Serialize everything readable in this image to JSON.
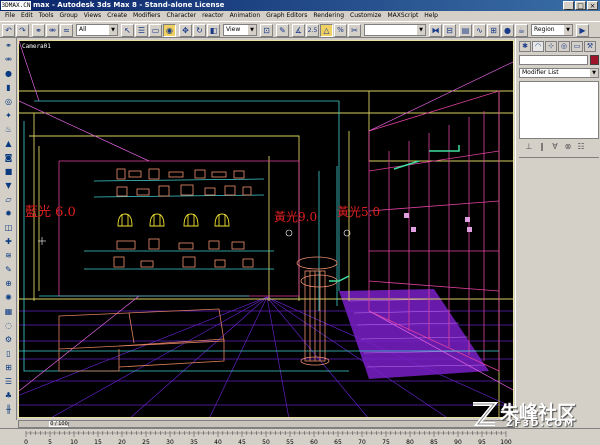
{
  "window": {
    "logo_text": "3DMAX.CN",
    "title": "max - Autodesk 3ds Max 8 - Stand-alone License",
    "controls": [
      "_",
      "□",
      "×"
    ]
  },
  "menu": [
    "File",
    "Edit",
    "Tools",
    "Group",
    "Views",
    "Create",
    "Modifiers",
    "Character",
    "reactor",
    "Animation",
    "Graph Editors",
    "Rendering",
    "Customize",
    "MAXScript",
    "Help"
  ],
  "toolbar": {
    "selection_filter": "All",
    "coord_system": "View",
    "snap_label": "2.5",
    "percent_snap_label": "%",
    "named_selection": "",
    "render_preset": "Region"
  },
  "viewport": {
    "label": "Camera01",
    "annotations": [
      "藍光 6.0",
      "黃光9.0",
      "黃光5.0"
    ],
    "colors": {
      "background": "#000000",
      "room": "#d8d060",
      "cyan_wire": "#40d0d0",
      "pink_wire": "#e040a0",
      "magenta_lines": "#e060e0",
      "floor_grid": "#6020c0",
      "shelf_items": "#f09070",
      "lamp": "#f0e030",
      "tub": "#9030d0",
      "faucet": "#40e0a0",
      "text_red": "#e02020"
    }
  },
  "command_panel": {
    "tabs": [
      "create-icon",
      "modify-icon",
      "hierarchy-icon",
      "motion-icon",
      "display-icon",
      "utilities-icon"
    ],
    "object_name": "",
    "object_color": "#a0142a",
    "modifier_list": "Modifier List"
  },
  "timeline": {
    "slider_label": "0 / 100",
    "ticks": [
      "0",
      "5",
      "10",
      "15",
      "20",
      "25",
      "30",
      "35",
      "40",
      "45",
      "50",
      "55",
      "60",
      "65",
      "70",
      "75",
      "80",
      "85",
      "90",
      "95",
      "100"
    ]
  },
  "watermark": {
    "chinese": "朱峰社区",
    "domain": "ZF3D.COM"
  }
}
